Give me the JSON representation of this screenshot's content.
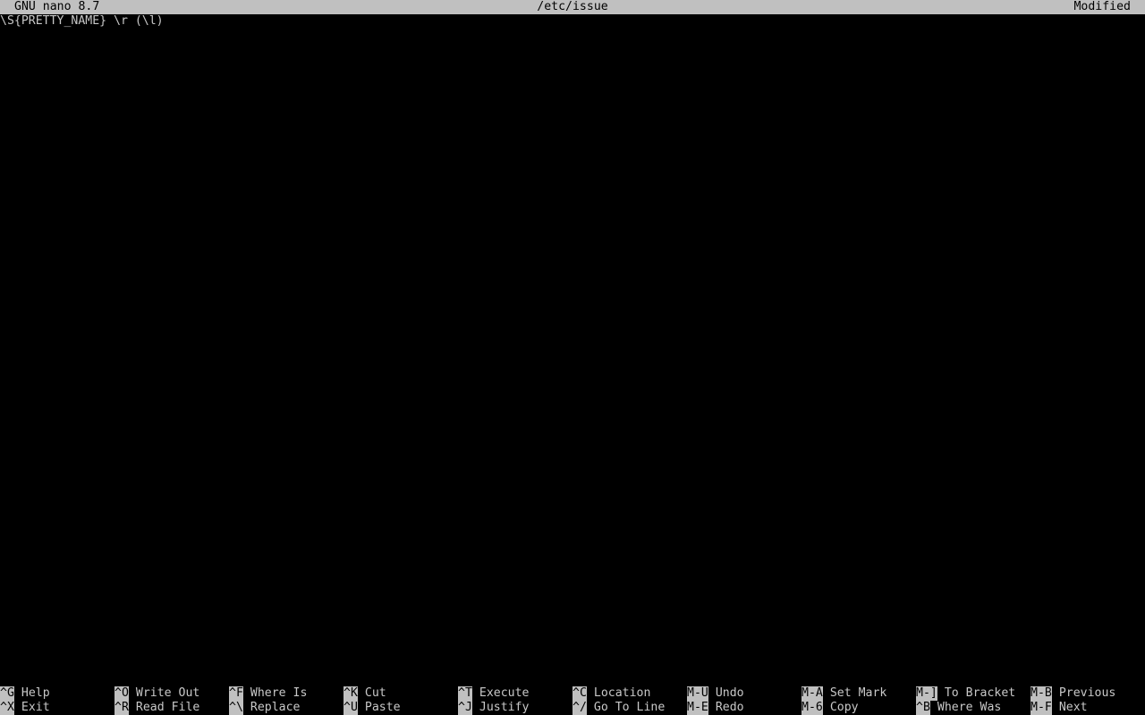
{
  "titlebar": {
    "version": "GNU nano 8.7",
    "filename": "/etc/issue",
    "status": "Modified"
  },
  "editor": {
    "lines": [
      "\\S{PRETTY_NAME} \\r (\\l)"
    ]
  },
  "shortcuts": {
    "row1": [
      {
        "key": "^G",
        "label": "Help"
      },
      {
        "key": "^O",
        "label": "Write Out"
      },
      {
        "key": "^F",
        "label": "Where Is"
      },
      {
        "key": "^K",
        "label": "Cut"
      },
      {
        "key": "^T",
        "label": "Execute"
      },
      {
        "key": "^C",
        "label": "Location"
      },
      {
        "key": "M-U",
        "label": "Undo"
      },
      {
        "key": "M-A",
        "label": "Set Mark"
      },
      {
        "key": "M-]",
        "label": "To Bracket"
      },
      {
        "key": "M-B",
        "label": "Previous"
      }
    ],
    "row2": [
      {
        "key": "^X",
        "label": "Exit"
      },
      {
        "key": "^R",
        "label": "Read File"
      },
      {
        "key": "^\\",
        "label": "Replace"
      },
      {
        "key": "^U",
        "label": "Paste"
      },
      {
        "key": "^J",
        "label": "Justify"
      },
      {
        "key": "^/",
        "label": "Go To Line"
      },
      {
        "key": "M-E",
        "label": "Redo"
      },
      {
        "key": "M-6",
        "label": "Copy"
      },
      {
        "key": "^B",
        "label": "Where Was"
      },
      {
        "key": "M-F",
        "label": "Next"
      }
    ]
  },
  "colors": {
    "background": "#000000",
    "bar": "#c0c0c0",
    "text": "#c8c8c8"
  }
}
